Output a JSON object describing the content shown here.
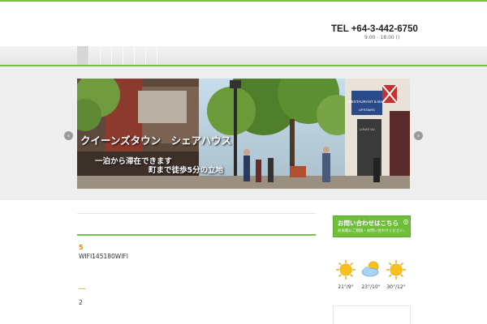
{
  "header": {
    "tel": "TEL +64-3-442-6750",
    "hours": "9:00 - 18:00 ()"
  },
  "nav": {
    "items": [
      "",
      "",
      "",
      "",
      "",
      "",
      ""
    ]
  },
  "slider": {
    "caption_title": "クイーンズタウン　シェアハウス",
    "caption_line1": "一泊から滞在できます",
    "caption_line2": "町まで徒歩5分の立地",
    "prev_icon": "chevron-left-icon",
    "next_icon": "chevron-right-icon",
    "scene_signs": {
      "restaurant": "RESTAURANT & BAR",
      "upstairs": "UPSTAIRS",
      "shop": "LOUIS VU"
    }
  },
  "main": {
    "item1_number": "5",
    "item1_text": "WIFI145180WIFI",
    "item2_number": "2"
  },
  "sidebar": {
    "contact_title": "お問い合わせはこちら",
    "contact_sub": "お気軽にご相談・お問い合わせください。",
    "weather": [
      {
        "icon": "sun-icon",
        "temp": "21°/9°"
      },
      {
        "icon": "sun-cloud-icon",
        "temp": "23°/10°"
      },
      {
        "icon": "sun-icon",
        "temp": "30°/12°"
      }
    ]
  },
  "colors": {
    "accent": "#7ac143",
    "contact_bg": "#6fbf3a",
    "number_orange": "#f08000",
    "band_bg": "#eeeeee"
  }
}
